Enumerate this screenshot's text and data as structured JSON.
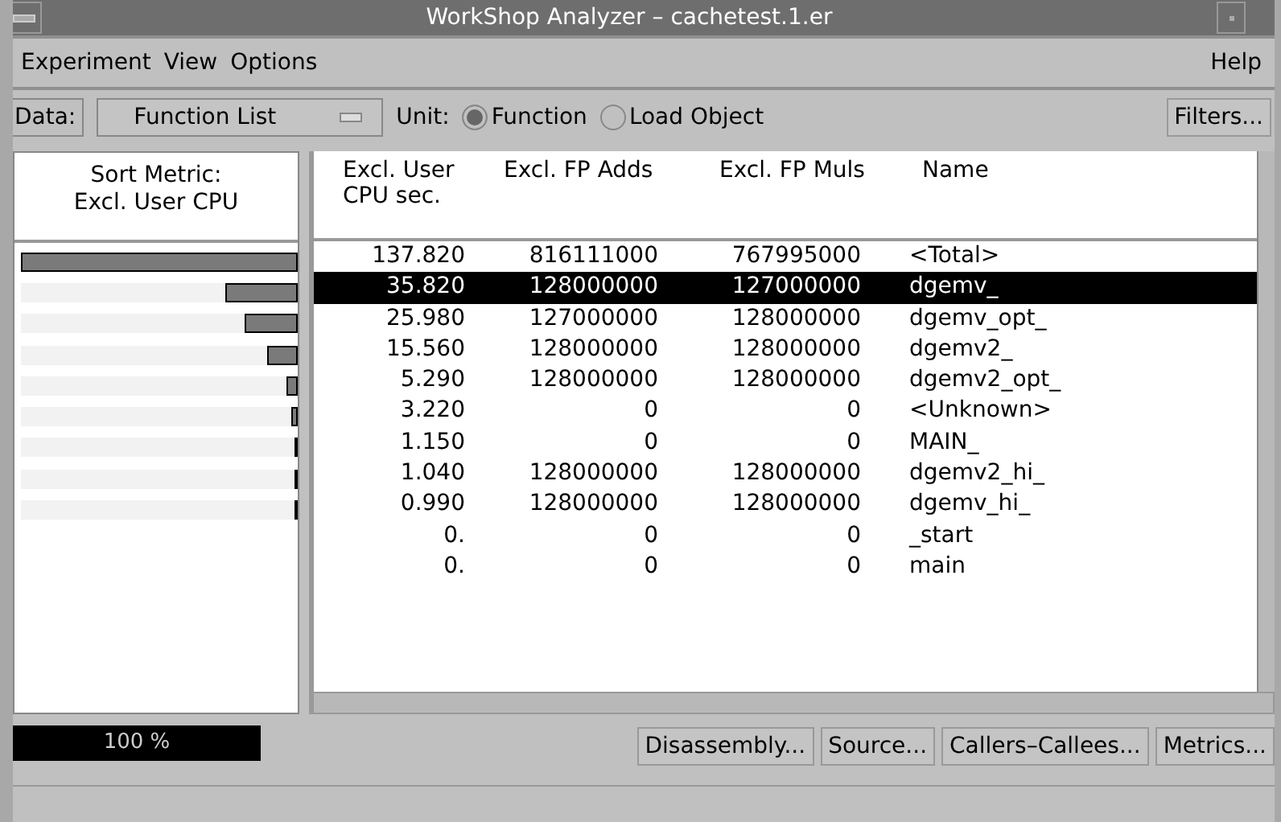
{
  "window": {
    "title": "WorkShop Analyzer – cachetest.1.er"
  },
  "menu": {
    "left": [
      "Experiment",
      "View",
      "Options"
    ],
    "right": "Help"
  },
  "toolbar": {
    "data_label": "Data:",
    "data_value": "Function List",
    "unit_label": "Unit:",
    "units": [
      {
        "label": "Function",
        "selected": true
      },
      {
        "label": "Load Object",
        "selected": false
      }
    ],
    "filters": "Filters..."
  },
  "metric_panel": {
    "header": [
      "Sort Metric:",
      "Excl. User CPU"
    ],
    "percent": "100 %"
  },
  "table": {
    "columns": [
      "Excl. User\nCPU sec.",
      "Excl. FP Adds",
      "Excl. FP Muls",
      "Name"
    ],
    "rows": [
      {
        "cells": [
          "137.820",
          "816111000",
          "767995000",
          "<Total>"
        ],
        "level": 1,
        "selected": false
      },
      {
        "cells": [
          "35.820",
          "128000000",
          "127000000",
          "dgemv_"
        ],
        "level": 0.26,
        "selected": true
      },
      {
        "cells": [
          "25.980",
          "127000000",
          "128000000",
          "dgemv_opt_"
        ],
        "level": 0.19,
        "selected": false
      },
      {
        "cells": [
          "15.560",
          "128000000",
          "128000000",
          "dgemv2_"
        ],
        "level": 0.113,
        "selected": false
      },
      {
        "cells": [
          "5.290",
          "128000000",
          "128000000",
          "dgemv2_opt_"
        ],
        "level": 0.038,
        "selected": false
      },
      {
        "cells": [
          "3.220",
          "0",
          "0",
          "<Unknown>"
        ],
        "level": 0.023,
        "selected": false
      },
      {
        "cells": [
          "1.150",
          "0",
          "0",
          "MAIN_"
        ],
        "level": 0.008,
        "selected": false
      },
      {
        "cells": [
          "1.040",
          "128000000",
          "128000000",
          "dgemv2_hi_"
        ],
        "level": 0.0075,
        "selected": false
      },
      {
        "cells": [
          "0.990",
          "128000000",
          "128000000",
          "dgemv_hi_"
        ],
        "level": 0.007,
        "selected": false
      },
      {
        "cells": [
          "0.",
          "0",
          "0",
          "_start"
        ],
        "selected": false
      },
      {
        "cells": [
          "0.",
          "0",
          "0",
          "main"
        ],
        "selected": false
      }
    ]
  },
  "buttons": [
    "Disassembly...",
    "Source...",
    "Callers–Callees...",
    "Metrics..."
  ]
}
